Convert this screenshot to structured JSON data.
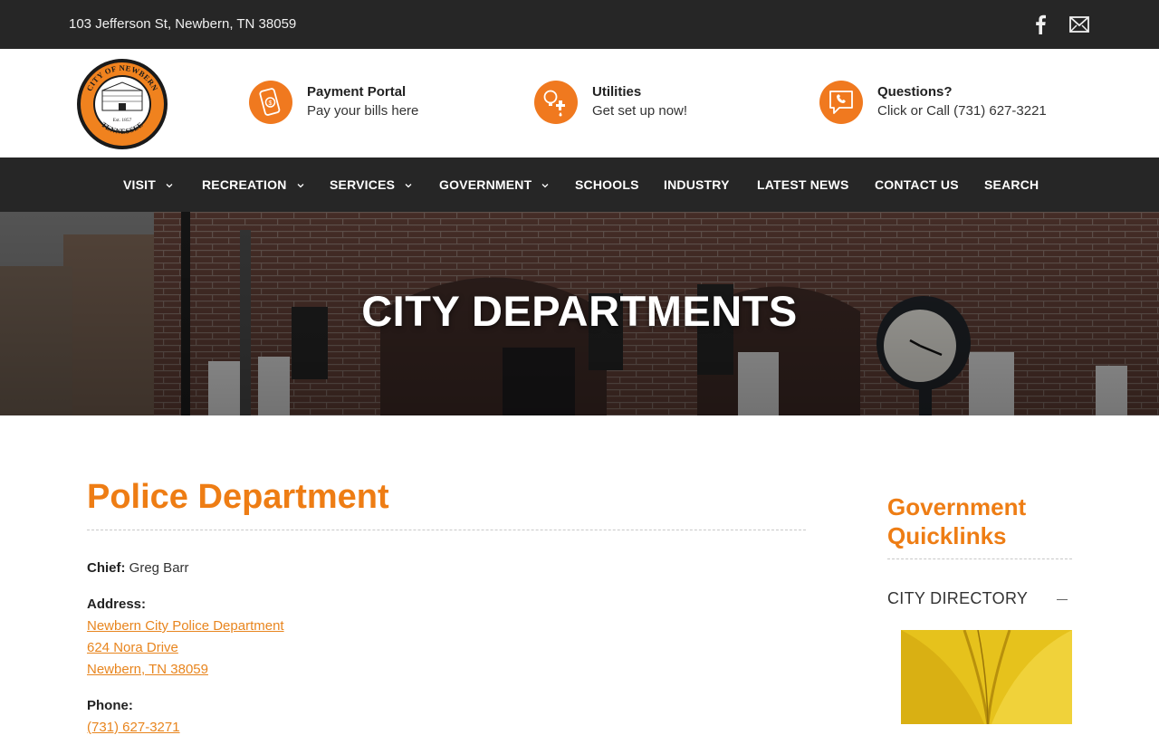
{
  "topbar": {
    "address": "103 Jefferson St, Newbern, TN 38059",
    "icons": [
      "facebook-icon",
      "mail-icon"
    ]
  },
  "header": {
    "logo_text": {
      "top": "CITY OF NEWBERN",
      "est": "Est. 1857",
      "bottom": "TENNESSEE"
    },
    "items": [
      {
        "title": "Payment Portal",
        "subtitle": "Pay your bills here",
        "icon": "phone-payment-icon"
      },
      {
        "title": "Utilities",
        "subtitle": "Get set up now!",
        "icon": "utilities-icon"
      },
      {
        "title": "Questions?",
        "subtitle": "Click or Call (731) 627-3221",
        "icon": "chat-phone-icon"
      }
    ]
  },
  "nav": {
    "items": [
      {
        "label": "VISIT",
        "dropdown": true
      },
      {
        "label": "RECREATION",
        "dropdown": true
      },
      {
        "label": "SERVICES",
        "dropdown": true
      },
      {
        "label": "GOVERNMENT",
        "dropdown": true
      },
      {
        "label": "SCHOOLS",
        "dropdown": false
      },
      {
        "label": "INDUSTRY",
        "dropdown": false
      },
      {
        "label": "LATEST NEWS",
        "dropdown": false
      },
      {
        "label": "CONTACT US",
        "dropdown": false
      },
      {
        "label": "SEARCH",
        "dropdown": false
      }
    ]
  },
  "hero": {
    "title": "CITY DEPARTMENTS"
  },
  "main": {
    "title": "Police Department",
    "chief_label": "Chief:",
    "chief_value": "Greg Barr",
    "address_label": "Address:",
    "address_lines": [
      "Newbern City Police Department",
      "624 Nora Drive",
      "Newbern, TN 38059"
    ],
    "phone_label": "Phone:",
    "phone_value": "(731) 627-3271"
  },
  "sidebar": {
    "title": "Government Quicklinks",
    "section": "CITY DIRECTORY"
  },
  "colors": {
    "accent": "#ee7d14",
    "dark_bar": "#262626",
    "link": "#e8851e"
  }
}
